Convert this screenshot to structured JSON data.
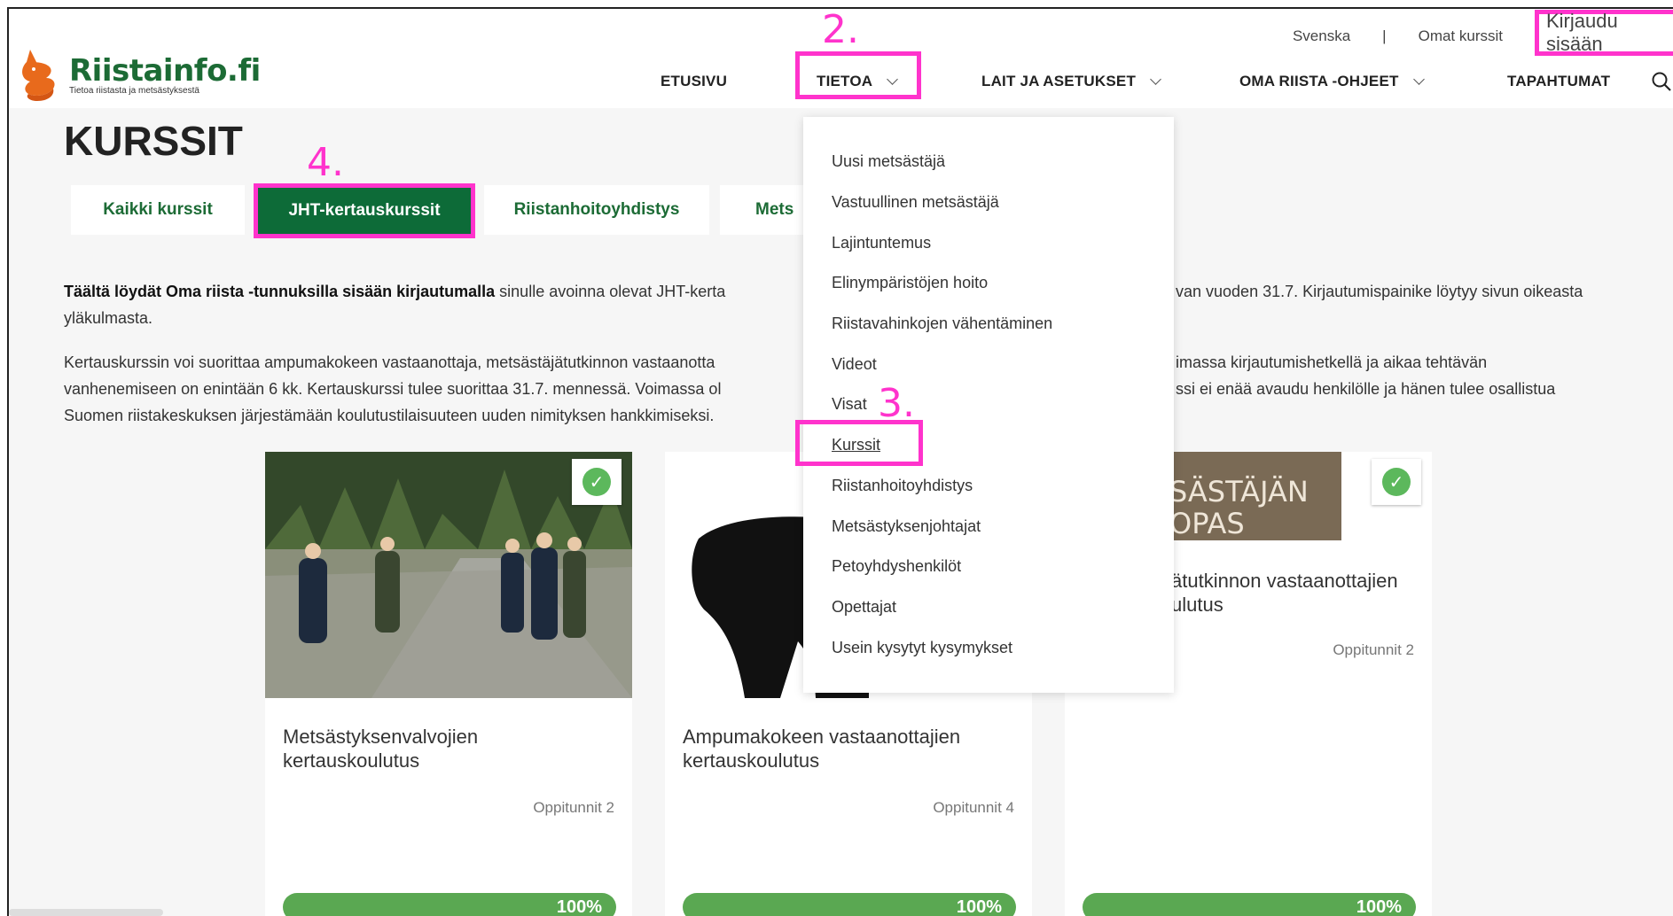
{
  "header": {
    "logo_title": "Riistainfo.fi",
    "logo_subtitle": "Tietoa riistasta ja metsästyksestä",
    "top_links": {
      "language": "Svenska",
      "separator": "|",
      "my_courses": "Omat kurssit",
      "login": "Kirjaudu sisään"
    },
    "nav": {
      "home": "ETUSIVU",
      "info": "TIETOA",
      "laws": "LAIT JA ASETUKSET",
      "oma_riista": "OMA RIISTA -OHJEET",
      "events": "TAPAHTUMAT"
    }
  },
  "annotations": {
    "step2": "2.",
    "step3": "3.",
    "step4": "4."
  },
  "page": {
    "title": "KURSSIT",
    "tabs": [
      "Kaikki kurssit",
      "JHT-kertauskurssit",
      "Riistanhoitoyhdistys",
      "Mets"
    ],
    "intro_bold": "Täältä löydät Oma riista -tunnuksilla sisään kirjautumalla",
    "intro_line1_a": " sinulle avoinna olevat JHT-kerta",
    "intro_line1_b": "van vuoden 31.7. Kirjautumispainike löytyy sivun oikeasta",
    "intro_line2": "yläkulmasta.",
    "p2_line1_a": "Kertauskurssin voi suorittaa ampumakokeen vastaanottaja, metsästäjätutkinnon vastaanotta",
    "p2_line1_b": "imassa kirjautumishetkellä ja aikaa tehtävän",
    "p2_line2_a": "vanhenemiseen on enintään 6 kk. Kertauskurssi tulee suorittaa 31.7. mennessä. Voimassa ol",
    "p2_line2_b": "ssi ei enää avaudu henkilölle ja hänen tulee osallistua",
    "p2_line3": "Suomen riistakeskuksen järjestämään koulutustilaisuuteen uuden nimityksen hankkimiseksi."
  },
  "cards": [
    {
      "title": "Metsästyksenvalvojien kertauskoulutus",
      "lessons": "Oppitunnit 2",
      "progress_label": "100%",
      "progress": 1.0
    },
    {
      "title": "Ampumakokeen vastaanottajien kertauskoulutus",
      "lessons": "Oppitunnit 4",
      "progress_label": "100%",
      "progress": 1.0
    },
    {
      "title": "ätutkinnon vastaanottajien ulutus",
      "title_l1": "ätutkinnon vastaanottajien",
      "title_l2": "ulutus",
      "image_text_1": "SÄSTÄJÄN",
      "image_text_2": "OPAS",
      "lessons": "Oppitunnit 2",
      "progress_label": "100%",
      "progress": 1.0
    }
  ],
  "dropdown": {
    "items": [
      "Uusi metsästäjä",
      "Vastuullinen metsästäjä",
      "Lajintuntemus",
      "Elinympäristöjen hoito",
      "Riistavahinkojen vähentäminen",
      "Videot",
      "Visat",
      "Kurssit",
      "Riistanhoitoyhdistys",
      "Metsästyksenjohtajat",
      "Petoyhdyshenkilöt",
      "Opettajat",
      "Usein kysytyt kysymykset"
    ],
    "current": "Kurssit"
  },
  "colors": {
    "brand_green": "#1c6b35",
    "active_tab": "#0d6b38",
    "highlight": "#ff33cc",
    "progress": "#5aa852",
    "check": "#5cb85c"
  }
}
